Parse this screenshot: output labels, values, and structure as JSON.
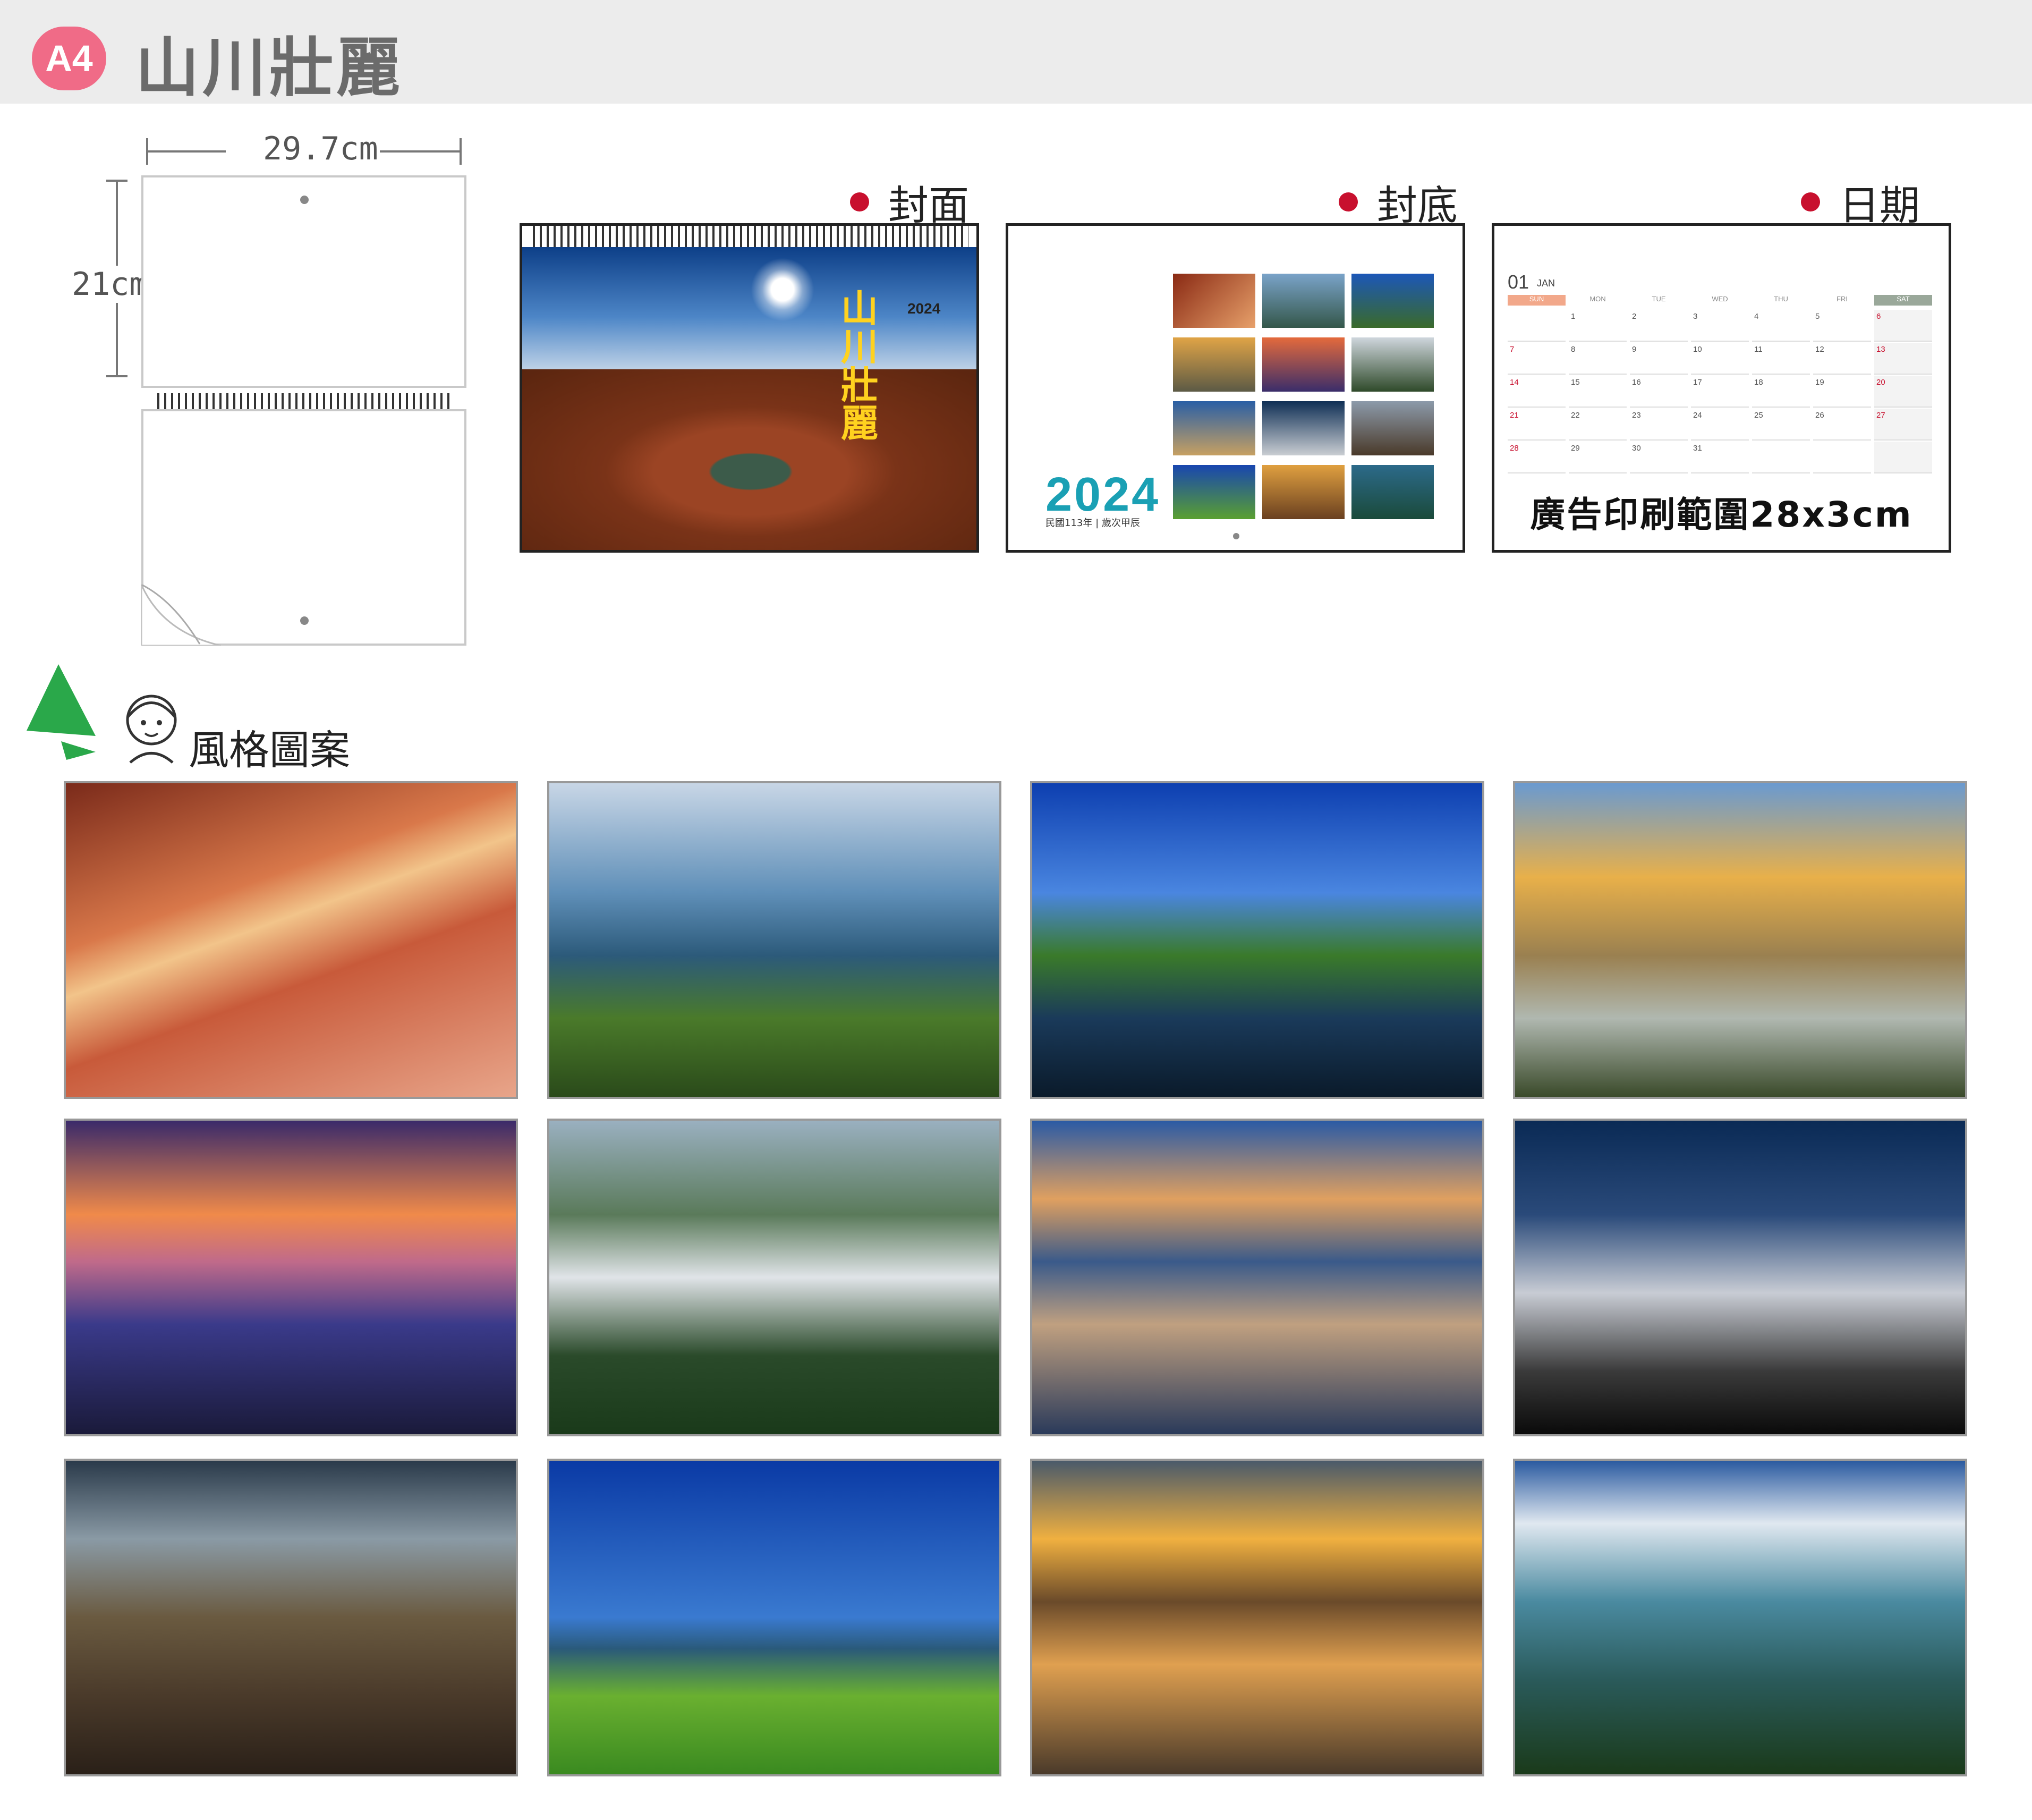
{
  "header": {
    "badge": "A4",
    "title": "山川壯麗"
  },
  "size": {
    "width": "29.7cm",
    "height": "21cm"
  },
  "previews": {
    "cover_label": "封面",
    "back_label": "封底",
    "date_label": "日期",
    "cover_title": "山川壯麗",
    "cover_year": "2024",
    "back_year": "2024",
    "back_sub": "民國113年 | 歲次甲辰",
    "cal_month_num": "01",
    "cal_month_name": "JAN",
    "cal_days": [
      "SUN",
      "MON",
      "TUE",
      "WED",
      "THU",
      "FRI",
      "SAT"
    ],
    "cal_rows": [
      [
        "",
        "1",
        "2",
        "3",
        "4",
        "5",
        "6"
      ],
      [
        "7",
        "8",
        "9",
        "10",
        "11",
        "12",
        "13"
      ],
      [
        "14",
        "15",
        "16",
        "17",
        "18",
        "19",
        "20"
      ],
      [
        "21",
        "22",
        "23",
        "24",
        "25",
        "26",
        "27"
      ],
      [
        "28",
        "29",
        "30",
        "31",
        "",
        "",
        ""
      ]
    ],
    "ad_text": "廣告印刷範圍28x3cm"
  },
  "style": {
    "heading": "風格圖案"
  },
  "colors": {
    "accent_red": "#c8102e",
    "badge_pink": "#f06b87",
    "teal": "#1aa0b4",
    "yellow": "#ffd21f"
  }
}
